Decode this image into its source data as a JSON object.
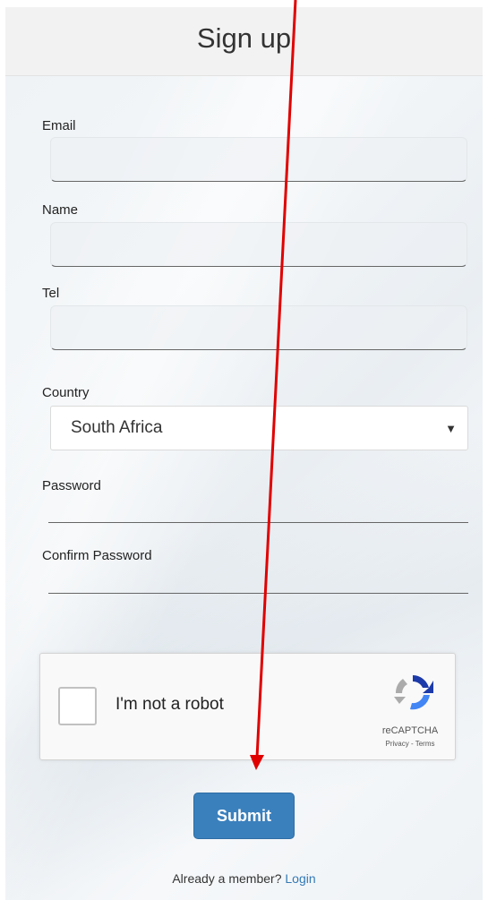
{
  "page": {
    "title": "Sign up"
  },
  "form": {
    "email_label": "Email",
    "email_value": "",
    "name_label": "Name",
    "name_value": "",
    "tel_label": "Tel",
    "tel_value": "",
    "country_label": "Country",
    "country_selected": "South Africa",
    "password_label": "Password",
    "confirm_password_label": "Confirm Password"
  },
  "captcha": {
    "checkbox_label": "I'm not a robot",
    "brand": "reCAPTCHA",
    "links": "Privacy - Terms",
    "checked": false
  },
  "submit_label": "Submit",
  "footer": {
    "text": "Already a member?",
    "login_label": "Login"
  },
  "colors": {
    "submit_bg": "#3a80bd",
    "link": "#337ab7",
    "annotation_arrow": "#e00000"
  },
  "icons": {
    "select_arrow": "caret-down-icon",
    "recaptcha": "recaptcha-logo-icon",
    "annotation": "red-arrow-annotation"
  }
}
